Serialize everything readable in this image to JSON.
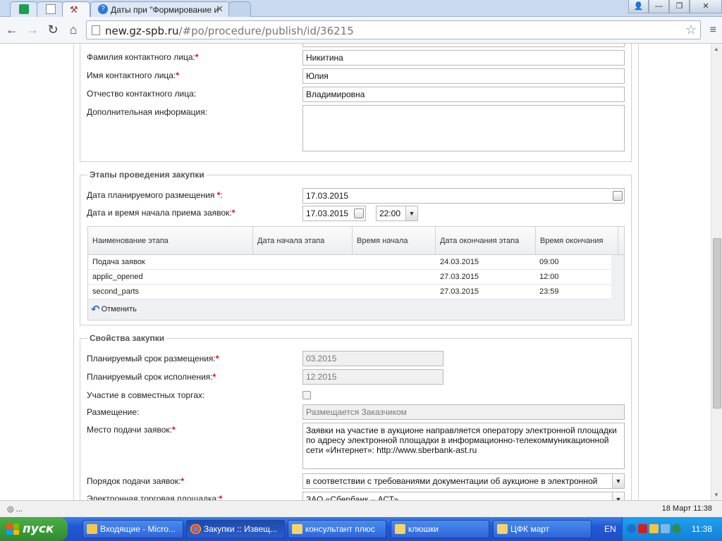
{
  "browser": {
    "tabs": [
      {
        "title": ""
      },
      {
        "title": ""
      },
      {
        "title": ""
      },
      {
        "title": "Даты при \"Формирование и"
      },
      {
        "title": ""
      }
    ],
    "url_host": "new.gz-spb.ru",
    "url_path": "/#po/procedure/publish/id/36215"
  },
  "contact": {
    "last_name_label": "Фамилия контактного лица:",
    "last_name_value": "Никитина",
    "first_name_label": "Имя контактного лица:",
    "first_name_value": "Юлия",
    "patronymic_label": "Отчество контактного лица:",
    "patronymic_value": "Владимировна",
    "extra_label": "Дополнительная информация:",
    "extra_value": ""
  },
  "stages": {
    "legend": "Этапы проведения закупки",
    "planned_date_label": "Дата планируемого размещения",
    "planned_date_value": "17.03.2015",
    "start_label": "Дата и время начала приема заявок:",
    "start_date": "17.03.2015",
    "start_time": "22:00",
    "columns": [
      "Наименование этапа",
      "Дата начала этапа",
      "Время начала",
      "Дата окончания этапа",
      "Время окончания"
    ],
    "rows": [
      {
        "name": "Подача заявок",
        "start_date": "",
        "start_time": "",
        "end_date": "24.03.2015",
        "end_time": "09:00"
      },
      {
        "name": "applic_opened",
        "start_date": "",
        "start_time": "",
        "end_date": "27.03.2015",
        "end_time": "12:00"
      },
      {
        "name": "second_parts",
        "start_date": "",
        "start_time": "",
        "end_date": "27.03.2015",
        "end_time": "23:59"
      }
    ],
    "cancel_label": "Отменить"
  },
  "props": {
    "legend": "Свойства закупки",
    "placement_term_label": "Планируемый срок размещения:",
    "placement_term_value": "03.2015",
    "execution_term_label": "Планируемый срок исполнения:",
    "execution_term_value": "12.2015",
    "joint_label": "Участие в совместных торгах:",
    "placement_label": "Размещение:",
    "placement_value": "Размещается Заказчиком",
    "place_label": "Место подачи заявок:",
    "place_value": "Заявки на участие в аукционе направляется оператору электронной площадки по адресу электронной площадки в информационно-телекоммуникационной сети «Интернет»: http://www.sberbank-ast.ru",
    "order_label": "Порядок подачи заявок:",
    "order_value": "в соответствии с требованиями документации об аукционе в электронной",
    "platform_label": "Электронная торговая площадка:",
    "platform_value": "ЗАО «Сбербанк – АСТ»"
  },
  "status": {
    "left": "◎ ...",
    "right": "18 Март 11:38"
  },
  "taskbar": {
    "start": "пуск",
    "buttons": [
      "Входящие - Micro...",
      "Закупки :: Извещ...",
      "консультант плюс",
      "клюшки",
      "ЦФК март"
    ],
    "lang": "EN",
    "clock": "11:38"
  }
}
